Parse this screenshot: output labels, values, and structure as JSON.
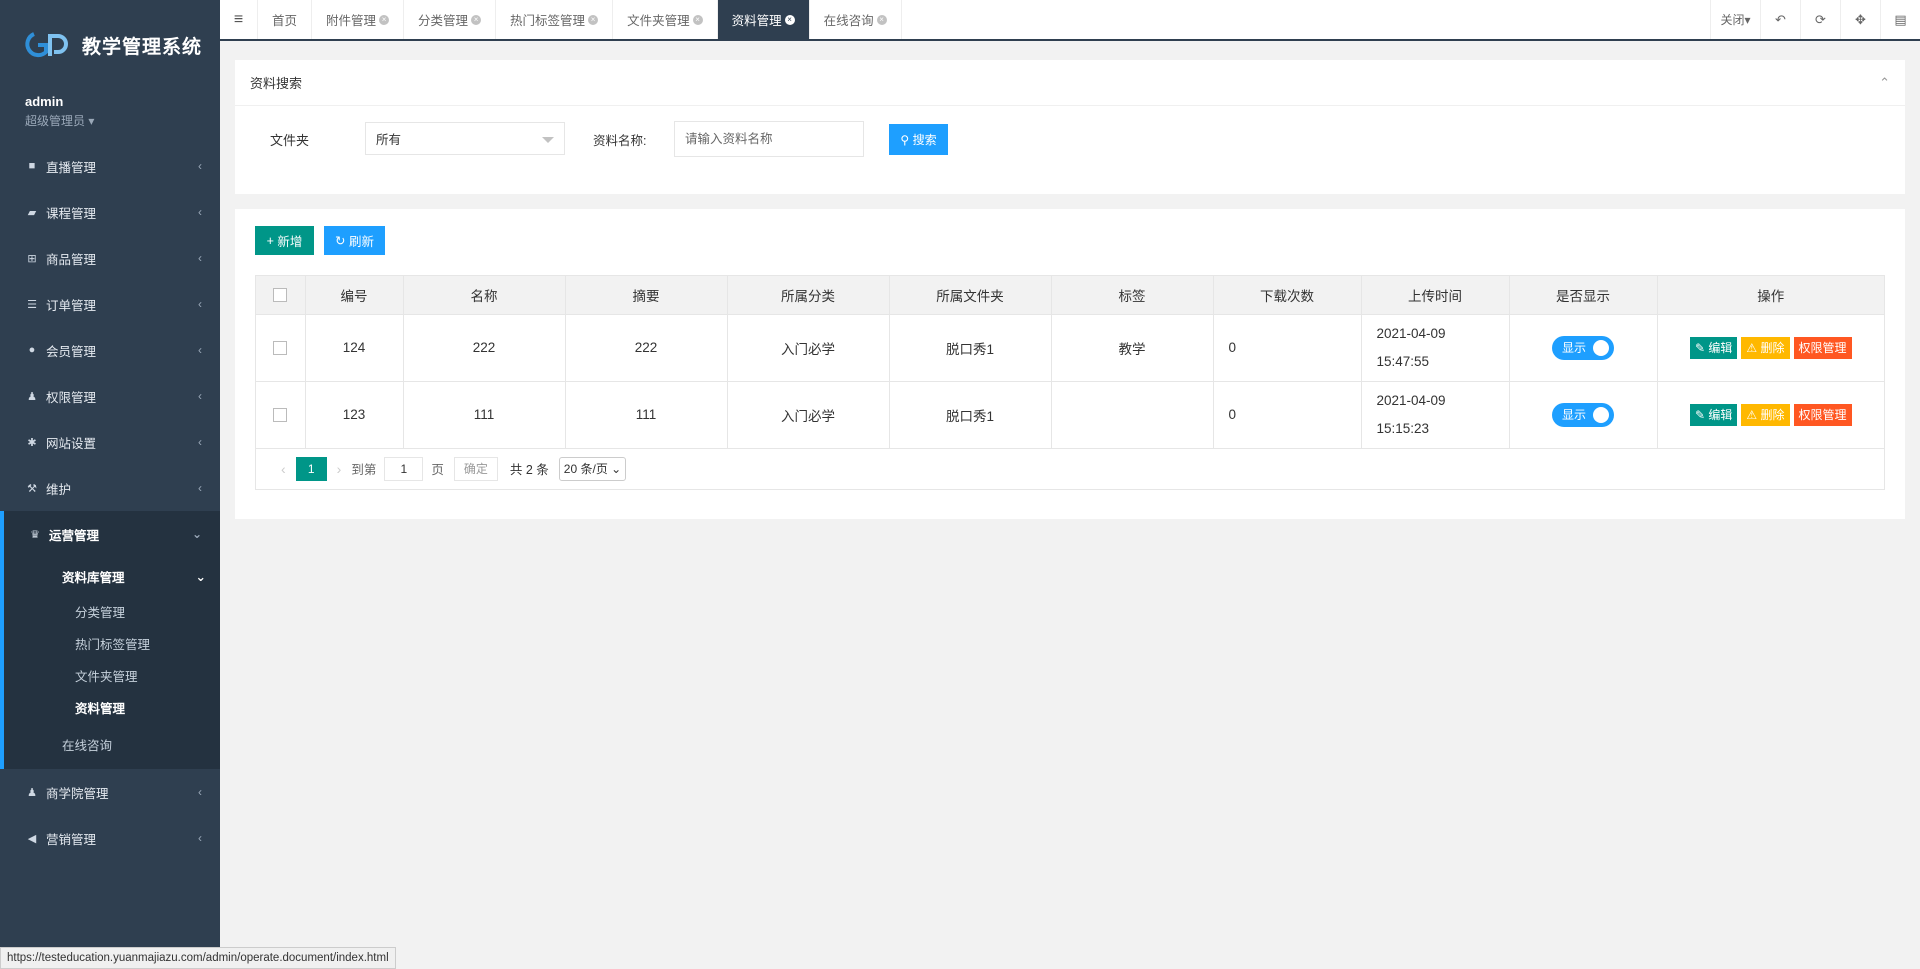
{
  "brand": {
    "title": "教学管理系统"
  },
  "user": {
    "name": "admin",
    "role": "超级管理员"
  },
  "sidebar": {
    "items_top": [
      {
        "label": "直播管理",
        "icon": "video-icon"
      },
      {
        "label": "课程管理",
        "icon": "book-icon"
      },
      {
        "label": "商品管理",
        "icon": "cart-icon"
      },
      {
        "label": "订单管理",
        "icon": "list-icon"
      },
      {
        "label": "会员管理",
        "icon": "user-icon"
      },
      {
        "label": "权限管理",
        "icon": "group-icon"
      },
      {
        "label": "网站设置",
        "icon": "gear-icon"
      },
      {
        "label": "维护",
        "icon": "wrench-icon"
      }
    ],
    "open_group": {
      "label": "运营管理",
      "sub_head": "资料库管理",
      "sub_items": [
        "分类管理",
        "热门标签管理",
        "文件夹管理",
        "资料管理"
      ],
      "sub_plain": "在线咨询"
    },
    "items_bottom": [
      {
        "label": "商学院管理",
        "icon": "group-icon"
      },
      {
        "label": "营销管理",
        "icon": "megaphone-icon"
      }
    ]
  },
  "tabs": [
    "首页",
    "附件管理",
    "分类管理",
    "热门标签管理",
    "文件夹管理",
    "资料管理",
    "在线咨询"
  ],
  "top_tools": {
    "close_label": "关闭"
  },
  "search": {
    "title": "资料搜索",
    "folder_label": "文件夹",
    "folder_value": "所有",
    "name_label": "资料名称:",
    "name_placeholder": "请输入资料名称",
    "button": "搜索"
  },
  "toolbar": {
    "add": "新增",
    "refresh": "刷新"
  },
  "table": {
    "headers": [
      "编号",
      "名称",
      "摘要",
      "所属分类",
      "所属文件夹",
      "标签",
      "下载次数",
      "上传时间",
      "是否显示",
      "操作"
    ],
    "rows": [
      {
        "id": "124",
        "name": "222",
        "summary": "222",
        "category": "入门必学",
        "folder": "脱口秀1",
        "tag": "教学",
        "downloads": "0",
        "date": "2021-04-09",
        "time": "15:47:55",
        "show": "显示"
      },
      {
        "id": "123",
        "name": "111",
        "summary": "111",
        "category": "入门必学",
        "folder": "脱口秀1",
        "tag": "",
        "downloads": "0",
        "date": "2021-04-09",
        "time": "15:15:23",
        "show": "显示"
      }
    ],
    "ops": {
      "edit": "编辑",
      "delete": "删除",
      "perm": "权限管理"
    }
  },
  "pager": {
    "current": "1",
    "goto_label": "到第",
    "goto_value": "1",
    "page_label": "页",
    "ok": "确定",
    "total": "共 2 条",
    "size": "20 条/页"
  },
  "status_url": "https://testeducation.yuanmajiazu.com/admin/operate.document/index.html",
  "colors": {
    "sidebar": "#2f3f50",
    "primary": "#1e9fff",
    "green": "#009688",
    "warn": "#ffb800",
    "danger": "#ff5722"
  }
}
